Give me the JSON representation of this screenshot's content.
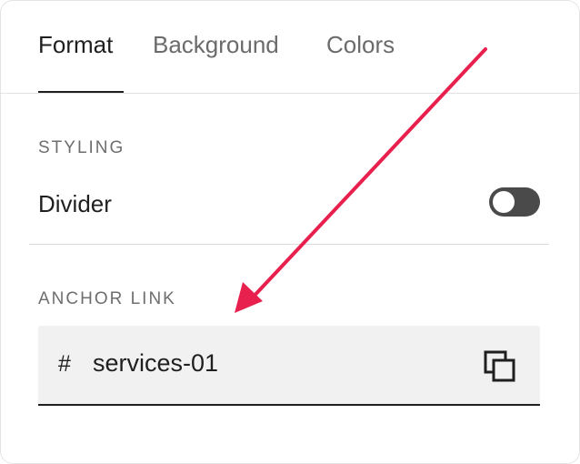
{
  "tabs": [
    {
      "label": "Format",
      "active": true
    },
    {
      "label": "Background",
      "active": false
    },
    {
      "label": "Colors",
      "active": false
    }
  ],
  "styling": {
    "heading": "STYLING",
    "divider_label": "Divider",
    "divider_toggle_on": false
  },
  "anchor": {
    "heading": "ANCHOR LINK",
    "prefix": "#",
    "value": "services-01"
  },
  "icons": {
    "copy": "copy-icon",
    "annotation": "arrow-annotation"
  },
  "colors": {
    "annotation_arrow": "#e8204e",
    "toggle_off": "#4a4a4a",
    "field_bg": "#f1f1f1"
  }
}
